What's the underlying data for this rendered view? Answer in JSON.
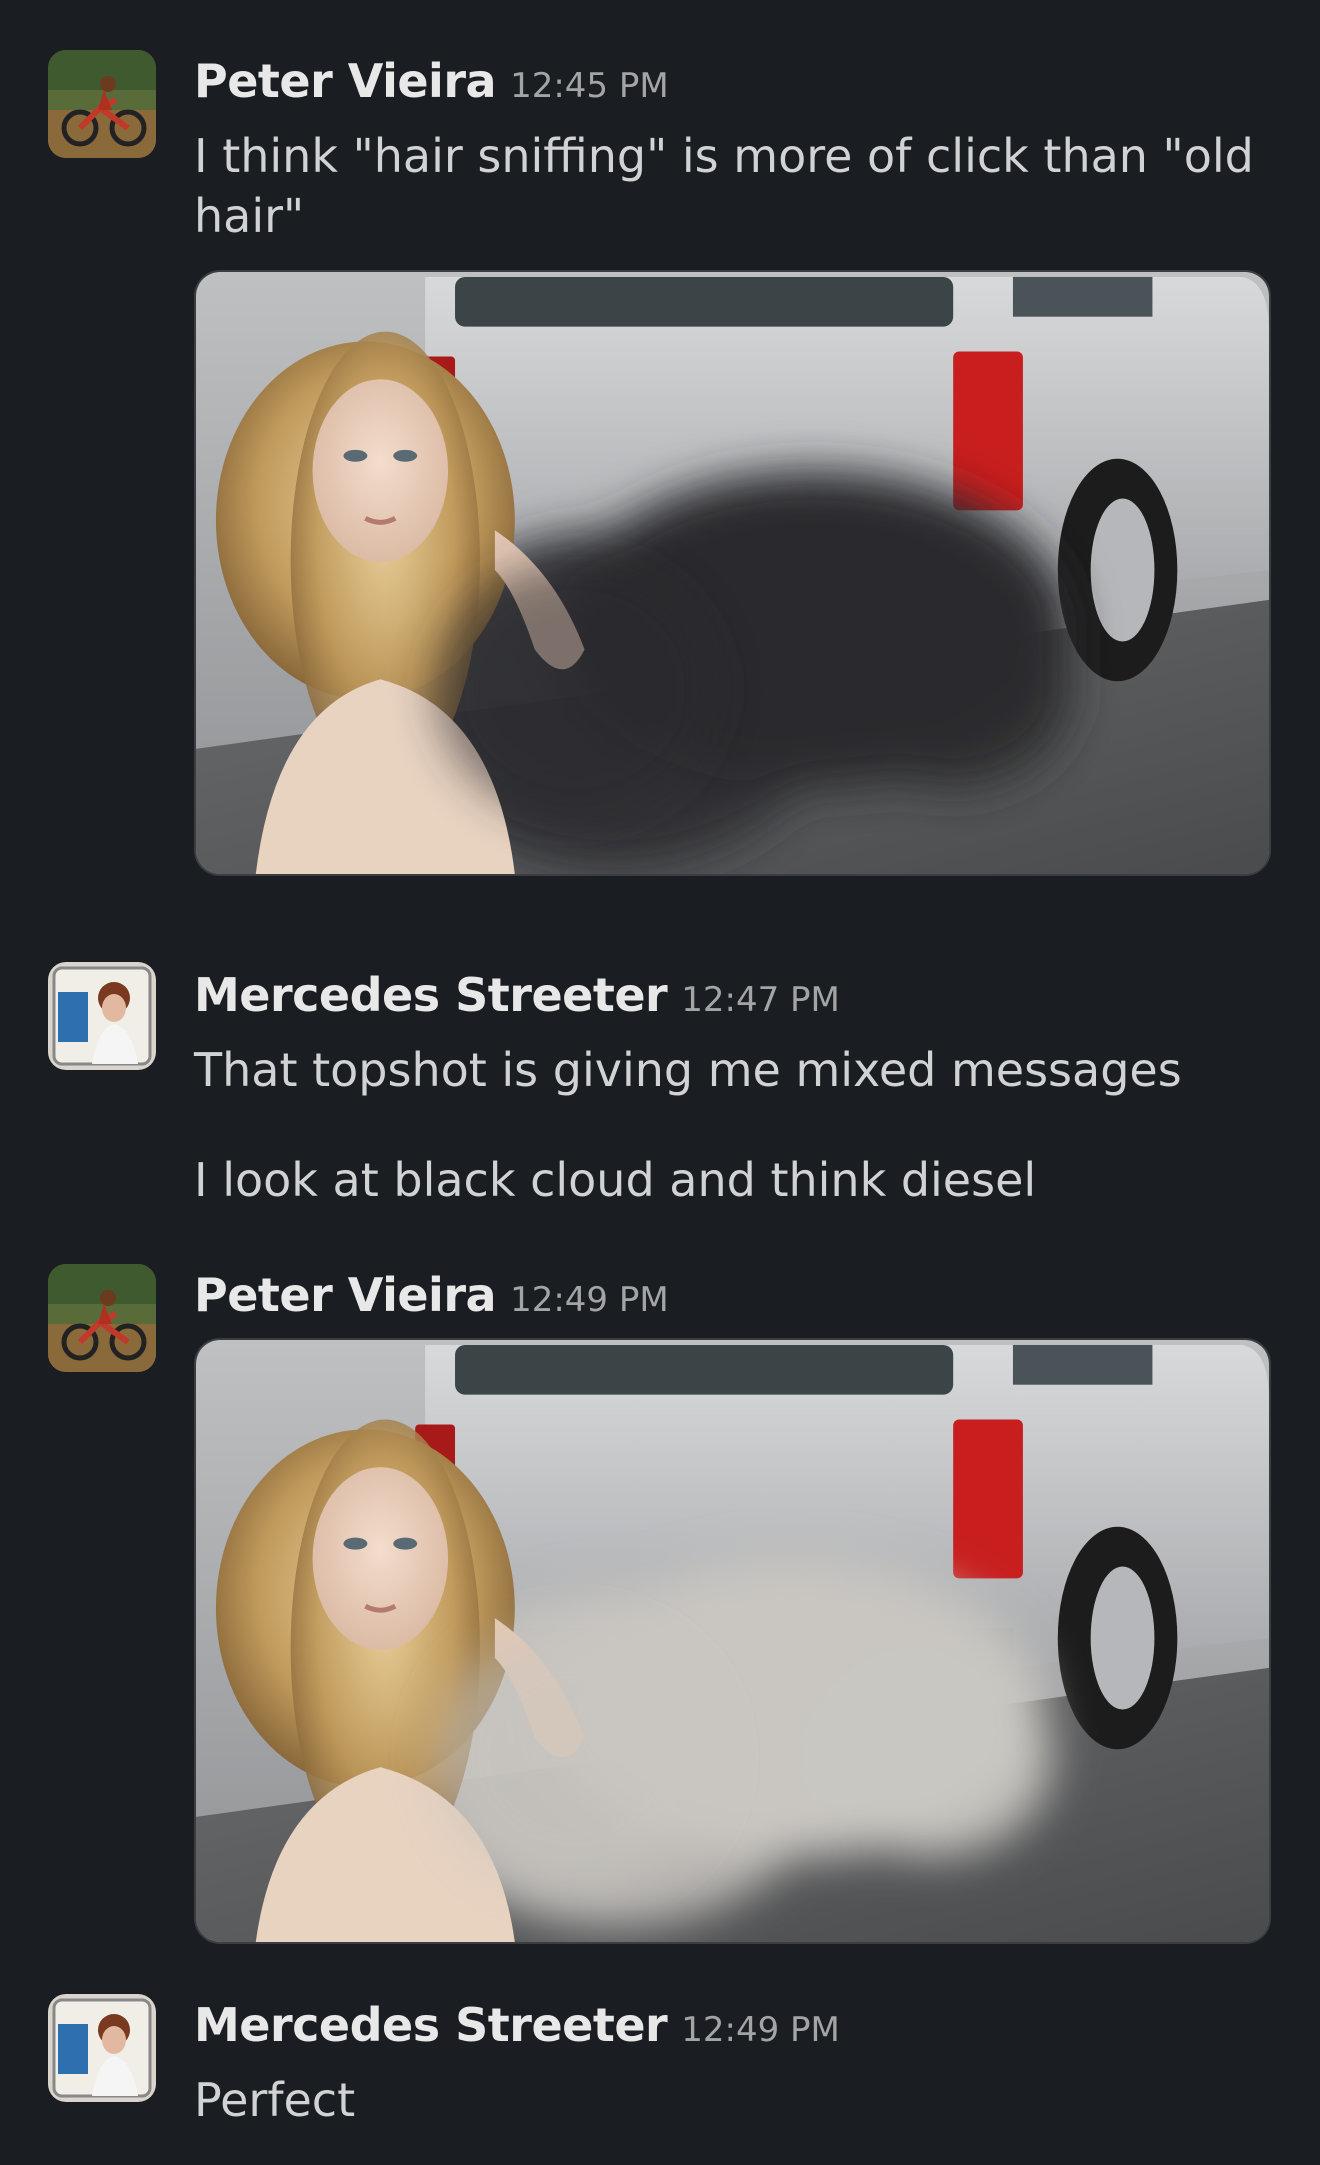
{
  "messages": [
    {
      "author": "Peter Vieira",
      "time": "12:45 PM",
      "avatar_icon": "motorbike-avatar-icon",
      "text": "I think \"hair sniffing\" is more of click than \"old hair\"",
      "attachment": {
        "icon": "woman-truck-black-smoke-image",
        "smoke_color": "#2c2c2e"
      }
    },
    {
      "author": "Mercedes Streeter",
      "time": "12:47 PM",
      "avatar_icon": "woman-portrait-avatar-icon",
      "lines": [
        "That topshot is giving me mixed messages",
        "I look at black cloud and think diesel"
      ]
    },
    {
      "author": "Peter Vieira",
      "time": "12:49 PM",
      "avatar_icon": "motorbike-avatar-icon",
      "attachment": {
        "icon": "woman-truck-white-smoke-image",
        "smoke_color": "#c9c6c1"
      }
    },
    {
      "author": "Mercedes Streeter",
      "time": "12:49 PM",
      "avatar_icon": "woman-portrait-avatar-icon",
      "text": "Perfect"
    }
  ],
  "colors": {
    "background": "#1a1d21",
    "author": "#e8e8e8",
    "timestamp": "#a3a4a6",
    "body_text": "#d1d2d3"
  }
}
